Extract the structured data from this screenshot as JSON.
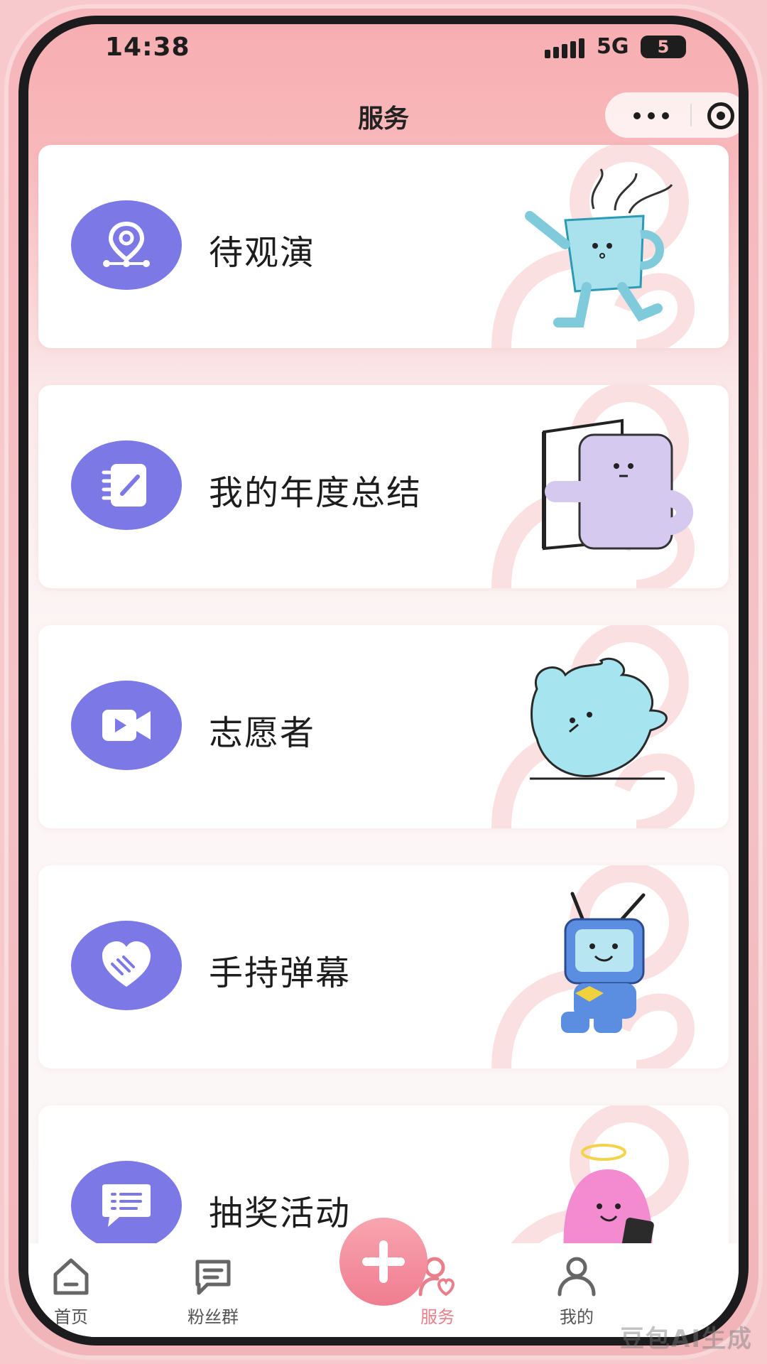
{
  "status_bar": {
    "time": "14:38",
    "network": "5G",
    "battery": "5"
  },
  "navbar": {
    "title": "服务",
    "more_icon": "more-dots-icon",
    "close_icon": "target-icon"
  },
  "cards": [
    {
      "label": "待观演",
      "icon": "location-pin-icon",
      "mascot": "cyan-cup-mascot"
    },
    {
      "label": "我的年度总结",
      "icon": "notebook-pen-icon",
      "mascot": "lavender-door-mascot"
    },
    {
      "label": "志愿者",
      "icon": "video-camera-icon",
      "mascot": "cyan-handstand-mascot"
    },
    {
      "label": "手持弹幕",
      "icon": "heart-handshake-icon",
      "mascot": "blue-tv-mascot"
    },
    {
      "label": "抽奖活动",
      "icon": "chat-bubble-icon",
      "mascot": "pink-phone-mascot"
    }
  ],
  "tabbar": {
    "items": [
      {
        "label": "首页",
        "icon": "home-icon"
      },
      {
        "label": "粉丝群",
        "icon": "chat-lines-icon"
      },
      {
        "label": "服务",
        "icon": "service-heart-icon",
        "active": true
      },
      {
        "label": "我的",
        "icon": "user-icon"
      }
    ],
    "fab_icon": "plus-icon"
  },
  "watermark": "豆包AI生成",
  "colors": {
    "accent": "#7c78e6",
    "pink": "#f7aeb2",
    "active_tab": "#e97f8b"
  }
}
